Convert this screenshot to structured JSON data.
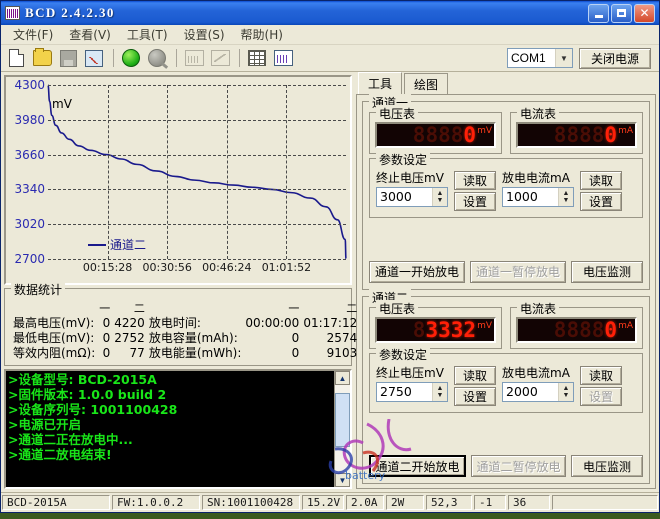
{
  "window": {
    "title": "BCD  2.4.2.30",
    "icon": "barcode-icon",
    "minimize": "minimize-icon",
    "maximize": "maximize-icon",
    "close": "close-icon"
  },
  "menu": [
    {
      "label": "文件(F)"
    },
    {
      "label": "查看(V)"
    },
    {
      "label": "工具(T)"
    },
    {
      "label": "设置(S)"
    },
    {
      "label": "帮助(H)"
    }
  ],
  "toolbar": {
    "icons": [
      {
        "name": "new-file-icon",
        "enabled": true
      },
      {
        "name": "open-folder-icon",
        "enabled": true
      },
      {
        "name": "save-icon",
        "enabled": false
      },
      {
        "name": "save-chart-icon",
        "enabled": true
      },
      {
        "name": "power-on-icon",
        "enabled": true
      },
      {
        "name": "power-off-icon",
        "enabled": false
      },
      {
        "name": "chart-bar-icon",
        "enabled": false
      },
      {
        "name": "chart-curve-icon",
        "enabled": false
      },
      {
        "name": "data-table-icon",
        "enabled": true
      },
      {
        "name": "plot-view-icon",
        "enabled": true
      }
    ],
    "port_value": "COM1",
    "port_arrow": "chevron-down-icon",
    "power_button": "关闭电源"
  },
  "chart_data": {
    "type": "line",
    "title": "",
    "xlabel": "",
    "ylabel": "mV",
    "ylim": [
      2700,
      4300
    ],
    "yticks": [
      2700,
      3020,
      3340,
      3660,
      3980,
      4300
    ],
    "xticks": [
      "00:15:28",
      "00:30:56",
      "00:46:24",
      "01:01:52"
    ],
    "grid": true,
    "legend": [
      {
        "name": "通道二",
        "color": "#1a1a8c"
      }
    ],
    "series": [
      {
        "name": "通道二",
        "color": "#1a1a8c",
        "x": [
          0,
          0.4,
          1.0,
          2.0,
          3.5,
          5.5,
          8.0,
          11.0,
          15.0,
          19.0,
          23.0,
          28.0,
          33.0,
          38.0,
          43.0,
          48.0,
          53.0,
          58.0,
          63.0,
          68.0,
          72.0,
          75.0,
          77.0,
          77.2
        ],
        "y": [
          4300,
          4150,
          4020,
          3930,
          3860,
          3800,
          3740,
          3700,
          3660,
          3620,
          3570,
          3510,
          3460,
          3425,
          3400,
          3380,
          3360,
          3340,
          3310,
          3260,
          3180,
          3060,
          2880,
          2700
        ]
      }
    ]
  },
  "stats": {
    "title": "数据统计",
    "col_headers": [
      "一",
      "二"
    ],
    "rows": [
      {
        "label": "最高电压(mV):",
        "ch1": "0",
        "ch2": "4220",
        "label2": "放电时间:",
        "ch1b": "00:00:00",
        "ch2b": "01:17:12"
      },
      {
        "label": "最低电压(mV):",
        "ch1": "0",
        "ch2": "2752",
        "label2": "放电容量(mAh):",
        "ch1b": "0",
        "ch2b": "2574"
      },
      {
        "label": "等效内阻(mΩ):",
        "ch1": "0",
        "ch2": "77",
        "label2": "放电能量(mWh):",
        "ch1b": "0",
        "ch2b": "9103"
      }
    ]
  },
  "console": {
    "lines": [
      ">设备型号: BCD-2015A",
      ">固件版本: 1.0.0 build 2",
      ">设备序列号: 1001100428",
      ">电源已开启",
      ">通道二正在放电中...",
      ">通道二放电结束!"
    ],
    "scroll_up": "scroll-up-icon",
    "scroll_down": "scroll-down-icon"
  },
  "tabs": [
    {
      "label": "工具",
      "active": true
    },
    {
      "label": "绘图",
      "active": false
    }
  ],
  "channel1": {
    "title": "通道一",
    "voltmeter": {
      "label": "电压表",
      "digits": "00000",
      "value": "0",
      "unit": "mV"
    },
    "ammeter": {
      "label": "电流表",
      "digits": "00000",
      "value": "0",
      "unit": "mA"
    },
    "params": {
      "title": "参数设定",
      "cutoff_label": "终止电压mV",
      "cutoff_value": "3000",
      "current_label": "放电电流mA",
      "current_value": "1000",
      "read_label": "读取",
      "set_label": "设置"
    },
    "actions": {
      "start": "通道一开始放电",
      "pause": "通道一暂停放电",
      "pause_enabled": false,
      "monitor": "电压监测"
    }
  },
  "channel2": {
    "title": "通道二",
    "voltmeter": {
      "label": "电压表",
      "digits": "03332",
      "value": "3332",
      "unit": "mV"
    },
    "ammeter": {
      "label": "电流表",
      "digits": "00000",
      "value": "0",
      "unit": "mA"
    },
    "params": {
      "title": "参数设定",
      "cutoff_label": "终止电压mV",
      "cutoff_value": "2750",
      "current_label": "放电电流mA",
      "current_value": "2000",
      "read_label": "读取",
      "set_label": "设置",
      "set_enabled": false
    },
    "actions": {
      "start": "通道二开始放电",
      "pause": "通道二暂停放电",
      "pause_enabled": false,
      "monitor": "电压监测"
    }
  },
  "statusbar": {
    "cells": [
      "BCD-2015A",
      "FW:1.0.0.2",
      "SN:1001100428",
      "15.2V",
      "2.0A",
      "2W",
      "52,3",
      "-1",
      "36",
      ""
    ]
  }
}
